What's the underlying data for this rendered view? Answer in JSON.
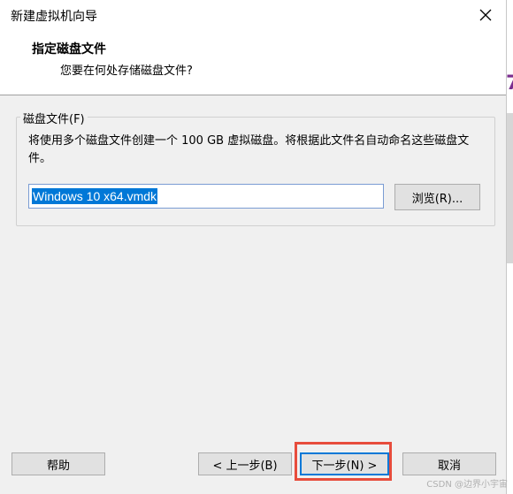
{
  "window": {
    "title": "新建虚拟机向导"
  },
  "header": {
    "title": "指定磁盘文件",
    "subtitle": "您要在何处存储磁盘文件?"
  },
  "group": {
    "label": "磁盘文件(F)",
    "description": "将使用多个磁盘文件创建一个 100 GB 虚拟磁盘。将根据此文件名自动命名这些磁盘文件。",
    "file_value": "Windows 10 x64.vmdk",
    "browse_label": "浏览(R)..."
  },
  "footer": {
    "help_label": "帮助",
    "back_label": "< 上一步(B)",
    "next_label": "下一步(N) >",
    "cancel_label": "取消"
  },
  "background": {
    "accent_glyph": "7"
  },
  "watermark": "CSDN @边界小宇宙"
}
